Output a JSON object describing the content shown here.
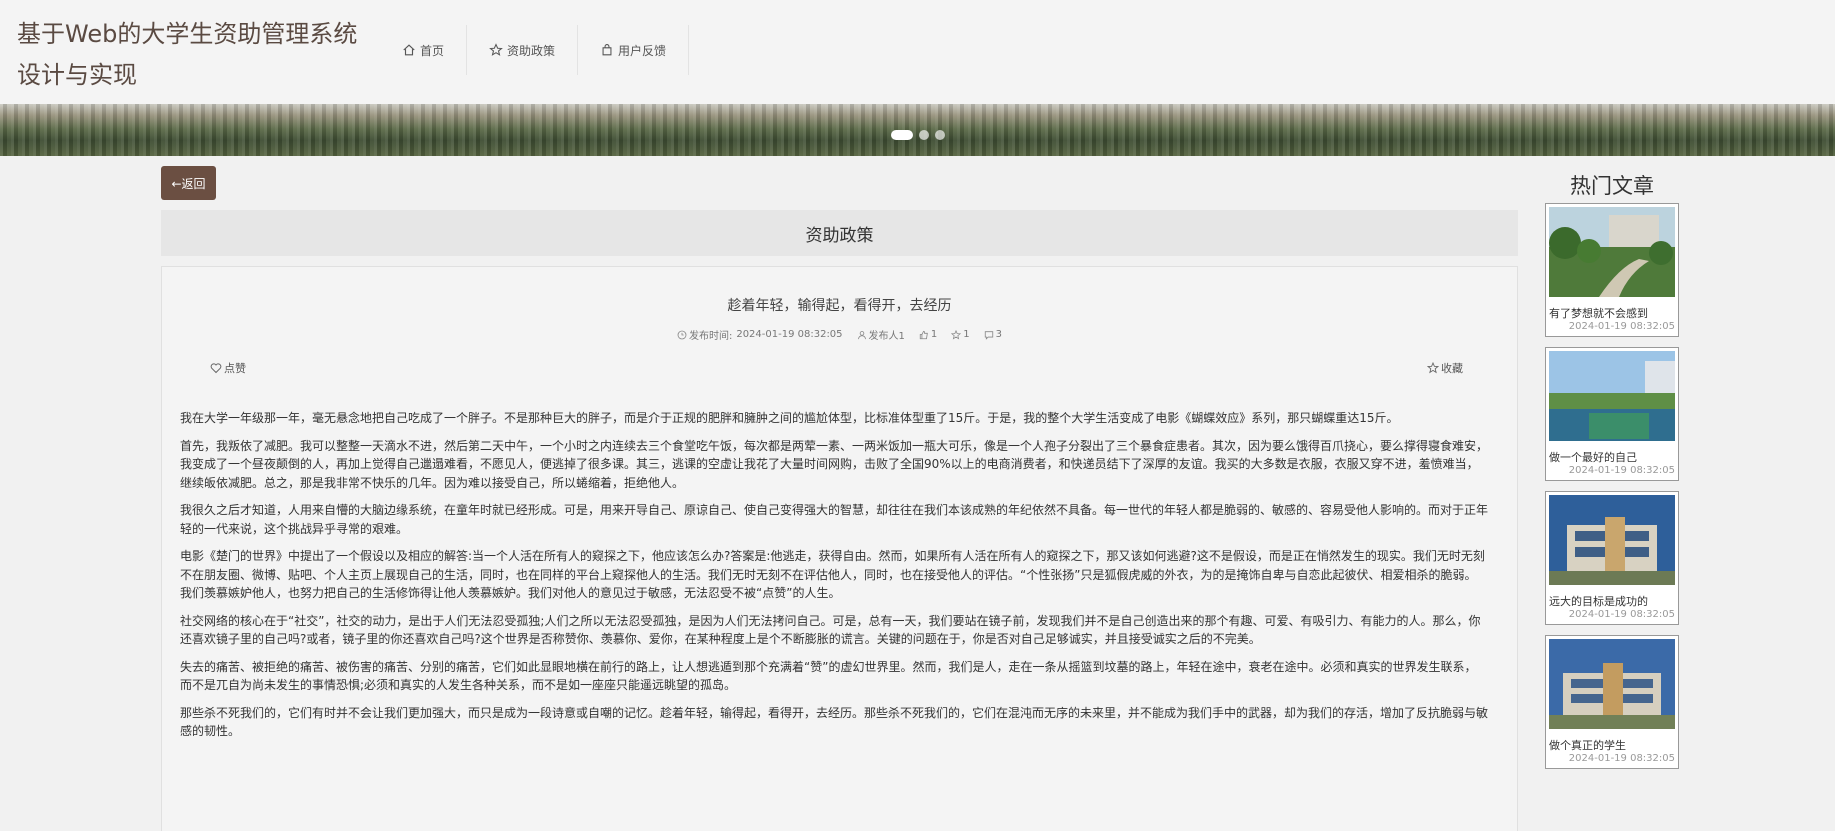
{
  "header": {
    "site_title": "基于Web的大学生资助管理系统设计与实现",
    "nav": [
      {
        "label": "首页",
        "icon": "home-icon"
      },
      {
        "label": "资助政策",
        "icon": "star-icon"
      },
      {
        "label": "用户反馈",
        "icon": "bag-icon"
      }
    ]
  },
  "banner": {
    "dots": 3,
    "active_dot": 1
  },
  "back_button": {
    "label": "←返回"
  },
  "section": {
    "title": "资助政策"
  },
  "article": {
    "title": "趁着年轻，输得起，看得开，去经历",
    "publish_label": "发布时间:",
    "publish_time": "2024-01-19 08:32:05",
    "author": "发布人1",
    "likes": "1",
    "stars": "1",
    "comments": "3",
    "like_label": "点赞",
    "fav_label": "收藏",
    "paragraphs": [
      "我在大学一年级那一年，毫无悬念地把自己吃成了一个胖子。不是那种巨大的胖子，而是介于正规的肥胖和臃肿之间的尴尬体型，比标准体型重了15斤。于是，我的整个大学生活变成了电影《蝴蝶效应》系列，那只蝴蝶重达15斤。",
      "首先，我叛依了减肥。我可以整整一天滴水不进，然后第二天中午，一个小时之内连续去三个食堂吃午饭，每次都是两荤一素、一两米饭加一瓶大可乐，像是一个人孢子分裂出了三个暴食症患者。其次，因为要么饿得百爪挠心，要么撑得寝食难安，我变成了一个昼夜颠倒的人，再加上觉得自己邋遢难看，不愿见人，便逃掉了很多课。其三，逃课的空虚让我花了大量时间网购，击败了全国90%以上的电商消费者，和快递员结下了深厚的友谊。我买的大多数是衣服，衣服又穿不进，羞愤难当，继续皈依减肥。总之，那是我非常不快乐的几年。因为难以接受自己，所以蜷缩着，拒绝他人。",
      "我很久之后才知道，人用来自懵的大脑边缘系统，在童年时就已经形成。可是，用来开导自己、原谅自己、使自己变得强大的智慧，却往往在我们本该成熟的年纪依然不具备。每一世代的年轻人都是脆弱的、敏感的、容易受他人影响的。而对于正年轻的一代来说，这个挑战异乎寻常的艰难。",
      "电影《楚门的世界》中提出了一个假设以及相应的解答:当一个人活在所有人的窥探之下，他应该怎么办?答案是:他逃走，获得自由。然而，如果所有人活在所有人的窥探之下，那又该如何逃避?这不是假设，而是正在悄然发生的现实。我们无时无刻不在朋友圈、微博、贴吧、个人主页上展现自己的生活，同时，也在同样的平台上窥探他人的生活。我们无时无刻不在评估他人，同时，也在接受他人的评估。“个性张扬”只是狐假虎威的外衣，为的是掩饰自卑与自恋此起彼伏、相爱相杀的脆弱。我们羡慕嫉妒他人，也努力把自己的生活修饰得让他人羡慕嫉妒。我们对他人的意见过于敏感，无法忍受不被“点赞”的人生。",
      "社交网络的核心在于“社交”，社交的动力，是出于人们无法忍受孤独;人们之所以无法忍受孤独，是因为人们无法拷问自己。可是，总有一天，我们要站在镜子前，发现我们并不是自己创造出来的那个有趣、可爱、有吸引力、有能力的人。那么，你还喜欢镜子里的自己吗?或者，镜子里的你还喜欢自己吗?这个世界是否称赞你、羡慕你、爱你，在某种程度上是个不断膨胀的谎言。关键的问题在于，你是否对自己足够诚实，并且接受诚实之后的不完美。",
      "失去的痛苦、被拒绝的痛苦、被伤害的痛苦、分别的痛苦，它们如此显眼地横在前行的路上，让人想逃遁到那个充满着“赞”的虚幻世界里。然而，我们是人，走在一条从摇篮到坟墓的路上，年轻在途中，衰老在途中。必须和真实的世界发生联系，而不是兀自为尚未发生的事情恐惧;必须和真实的人发生各种关系，而不是如一座座只能遥远眺望的孤岛。",
      "那些杀不死我们的，它们有时并不会让我们更加强大，而只是成为一段诗意或自嘲的记忆。趁着年轻，输得起，看得开，去经历。那些杀不死我们的，它们在混沌而无序的未来里，并不能成为我们手中的武器，却为我们的存活，增加了反抗脆弱与敏感的韧性。"
    ]
  },
  "sidebar": {
    "title": "热门文章",
    "items": [
      {
        "name": "有了梦想就不会感到",
        "date": "2024-01-19 08:32:05"
      },
      {
        "name": "做一个最好的自己",
        "date": "2024-01-19 08:32:05"
      },
      {
        "name": "远大的目标是成功的",
        "date": "2024-01-19 08:32:05"
      },
      {
        "name": "做个真正的学生",
        "date": "2024-01-19 08:32:05"
      }
    ]
  },
  "colors": {
    "accent": "#6b4f42",
    "title": "#5a4a42"
  }
}
